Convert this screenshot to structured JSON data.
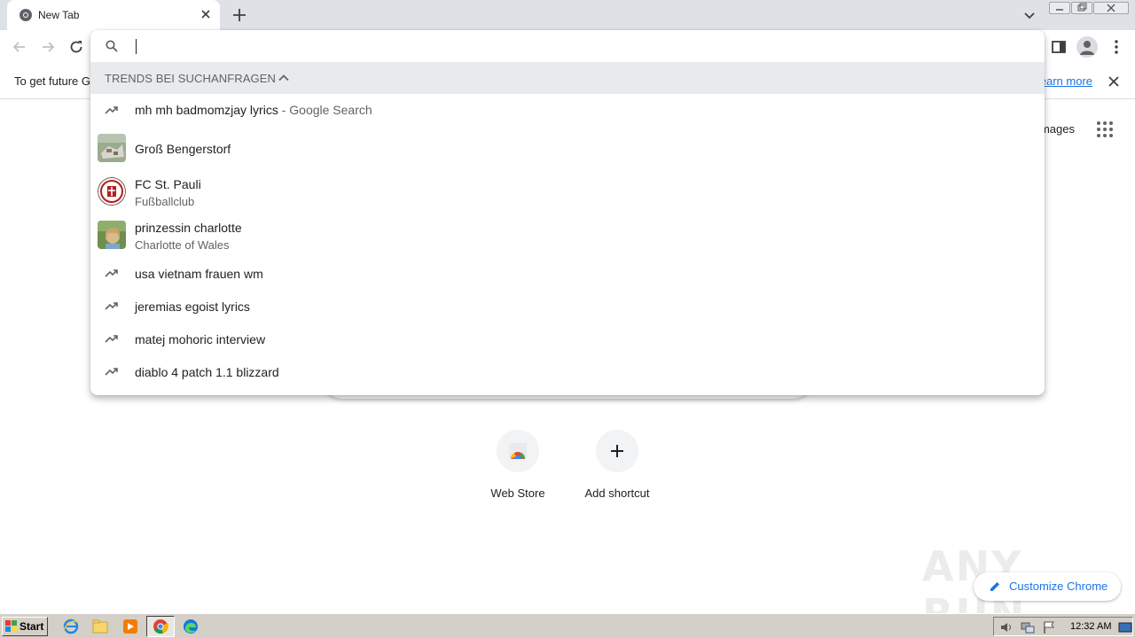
{
  "tab": {
    "title": "New Tab",
    "favicon": "chrome-icon"
  },
  "window_controls": [
    "minimize",
    "restore",
    "close"
  ],
  "infobar": {
    "text": "To get future G",
    "link": "Learn more"
  },
  "omnibox": {
    "value": "",
    "placeholder": "",
    "section_title": "TRENDS BEI SUCHANFRAGEN",
    "suggestions": [
      {
        "main": "mh mh badmomzjay lyrics",
        "inline_sub": " - Google Search",
        "sub": "",
        "icon": "trending-icon"
      },
      {
        "main": "Groß Bengerstorf",
        "inline_sub": "",
        "sub": "",
        "icon": "place-thumbnail"
      },
      {
        "main": "FC St. Pauli",
        "inline_sub": "",
        "sub": "Fußballclub",
        "icon": "club-logo"
      },
      {
        "main": "prinzessin charlotte",
        "inline_sub": "",
        "sub": "Charlotte of Wales",
        "icon": "person-thumbnail"
      },
      {
        "main": "usa vietnam frauen wm",
        "inline_sub": "",
        "sub": "",
        "icon": "trending-icon"
      },
      {
        "main": "jeremias egoist lyrics",
        "inline_sub": "",
        "sub": "",
        "icon": "trending-icon"
      },
      {
        "main": "matej mohoric interview",
        "inline_sub": "",
        "sub": "",
        "icon": "trending-icon"
      },
      {
        "main": "diablo 4 patch 1.1 blizzard",
        "inline_sub": "",
        "sub": "",
        "icon": "trending-icon"
      }
    ]
  },
  "ntp": {
    "images_link": "Images",
    "shortcuts": [
      {
        "label": "Web Store"
      },
      {
        "label": "Add shortcut"
      }
    ],
    "customize_label": "Customize Chrome",
    "watermark": "ANY RUN"
  },
  "taskbar": {
    "start_label": "Start",
    "clock": "12:32 AM"
  },
  "colors": {
    "accent": "#1a73e8",
    "tabstrip": "#dee1e6",
    "taskbar": "#d4d0c8"
  }
}
